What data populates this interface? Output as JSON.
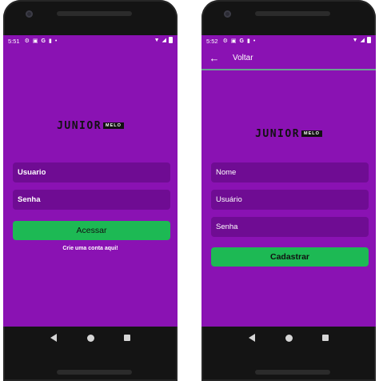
{
  "login_screen": {
    "status_time": "5:51",
    "logo_word": "JUNIOR",
    "logo_tag": "MELO",
    "username_placeholder": "Usuario",
    "password_placeholder": "Senha",
    "login_button": "Acessar",
    "signup_link": "Crie uma conta aqui!"
  },
  "signup_screen": {
    "status_time": "5:52",
    "back_label": "Voltar",
    "logo_word": "JUNIOR",
    "logo_tag": "MELO",
    "name_placeholder": "Nome",
    "username_placeholder": "Usuário",
    "password_placeholder": "Senha",
    "register_button": "Cadastrar"
  },
  "status_icons": [
    "gear-icon",
    "notification-icon",
    "google-icon",
    "sd-card-icon",
    "dot-icon",
    "wifi-icon",
    "signal-icon",
    "battery-icon"
  ],
  "nav_icons": [
    "nav-back-icon",
    "nav-home-icon",
    "nav-recent-icon"
  ],
  "colors": {
    "screen_bg": "#8a12b3",
    "field_bg": "#6f0c93",
    "button_green": "#1db954",
    "appbar_line": "#6aa390"
  }
}
